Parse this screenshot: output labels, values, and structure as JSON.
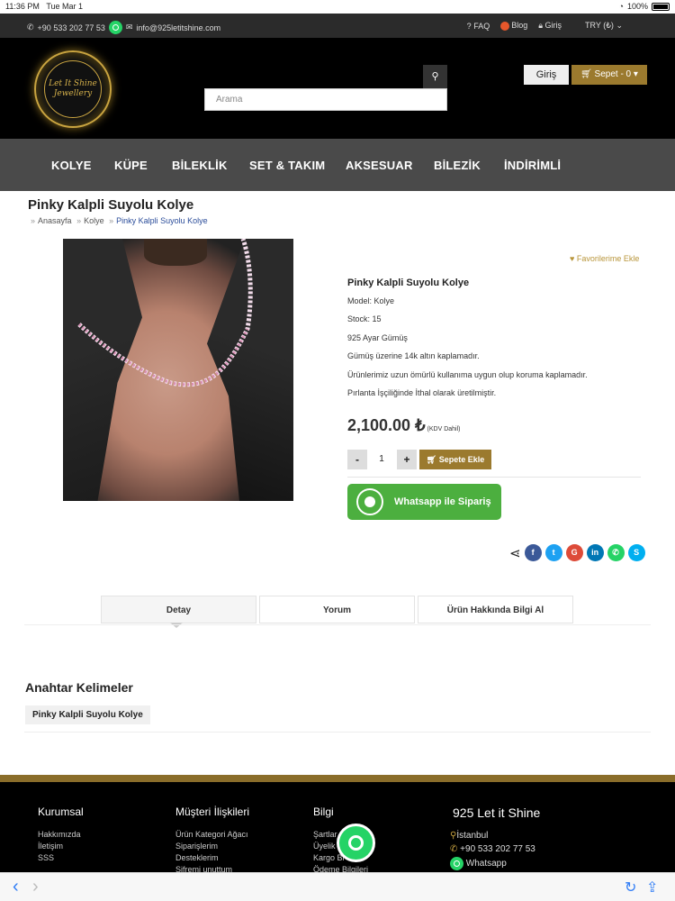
{
  "status_bar": {
    "time": "11:36 PM",
    "date": "Tue Mar 1",
    "battery": "100%"
  },
  "topbar": {
    "phone": "+90 533 202 77 53",
    "email": "info@925letitshine.com",
    "faq": "FAQ",
    "blog": "Blog",
    "login": "Giriş",
    "currency": "TRY (₺)"
  },
  "header": {
    "logo_line1": "Let It Shine",
    "logo_line2": "Jewellery",
    "search_placeholder": "Arama",
    "login_button": "Giriş",
    "cart_button": "Sepet - 0"
  },
  "nav": {
    "items": [
      "KOLYE",
      "KÜPE",
      "BİLEKLİK",
      "SET & TAKIM",
      "AKSESUAR",
      "BİLEZİK",
      "İNDİRİMLİ"
    ]
  },
  "product": {
    "page_title": "Pinky Kalpli Suyolu Kolye",
    "breadcrumb": [
      "Anasayfa",
      "Kolye",
      "Pinky Kalpli Suyolu Kolye"
    ],
    "favorite": "Favorilerime Ekle",
    "name": "Pinky Kalpli Suyolu Kolye",
    "model": "Model: Kolye",
    "stock": "Stock: 15",
    "material": "925 Ayar Gümüş",
    "plating": "Gümüş üzerine 14k altın kaplamadır.",
    "coating": "Ürünlerimiz uzun ömürlü kullanıma uygun olup koruma kaplamadır.",
    "stones": "Pırlanta İşçiliğinde İthal olarak üretilmiştir.",
    "price": "2,100.00 ₺",
    "price_note": "(KDV Dahil)",
    "qty_minus": "-",
    "qty_value": "1",
    "qty_plus": "+",
    "add_to_cart": "Sepete Ekle",
    "whatsapp_order": "Whatsapp ile Sipariş"
  },
  "tabs": [
    "Detay",
    "Yorum",
    "Ürün Hakkında Bilgi Al"
  ],
  "keywords": {
    "title": "Anahtar Kelimeler",
    "tag": "Pinky Kalpli Suyolu Kolye"
  },
  "footer": {
    "kurumsal": {
      "title": "Kurumsal",
      "links": [
        "Hakkımızda",
        "İletişim",
        "SSS"
      ]
    },
    "musteri": {
      "title": "Müşteri İlişkileri",
      "links": [
        "Ürün Kategori Ağacı",
        "Siparişlerim",
        "Desteklerim",
        "Şifremi unuttum"
      ]
    },
    "bilgi": {
      "title": "Bilgi",
      "links": [
        "Şartlar",
        "Üyelik",
        "Kargo Bi",
        "Ödeme Bilgileri"
      ]
    },
    "brand": {
      "title": "925 Let it Shine",
      "city": "İstanbul",
      "phone": "+90 533 202 77 53",
      "whatsapp": "Whatsapp"
    }
  },
  "colors": {
    "gold": "#9b7a2e",
    "nav_bg": "#4a4a4a",
    "whatsapp": "#4caf3f",
    "link_blue": "#2b4d9a"
  }
}
